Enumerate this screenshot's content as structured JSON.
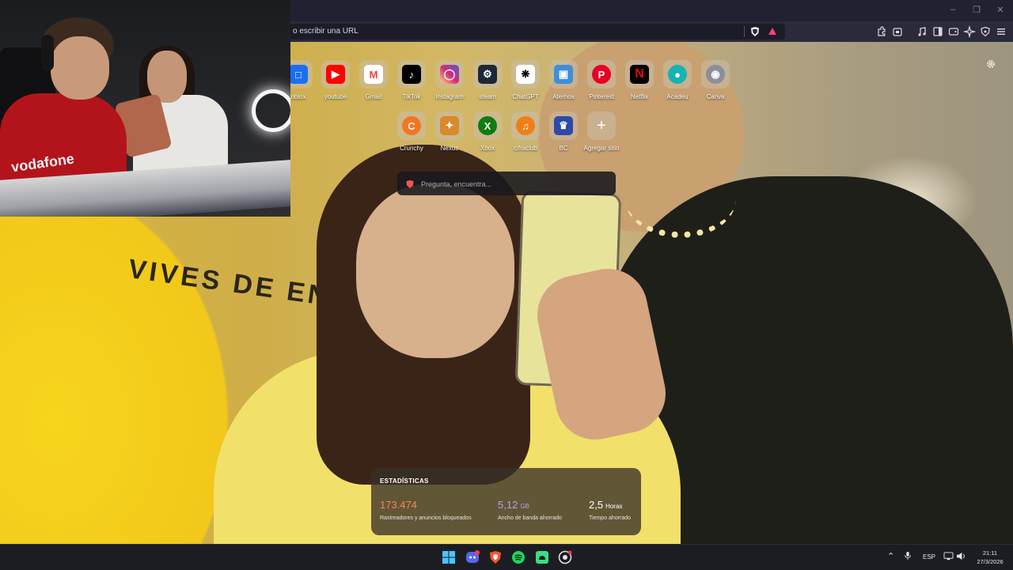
{
  "browser": {
    "url_placeholder": "o escribir una URL"
  },
  "webcam": {
    "shirt_brand": "vodafone"
  },
  "background": {
    "wall_text": "VIVES DE ENSA"
  },
  "speed_dial": {
    "row1": [
      {
        "label": "oblox",
        "icon": "roblox-icon",
        "color": "#1b6ef2"
      },
      {
        "label": "youtube",
        "icon": "youtube-icon",
        "color": "#ff0000"
      },
      {
        "label": "Gmail",
        "icon": "gmail-icon",
        "color": "#ea4335"
      },
      {
        "label": "TikTok",
        "icon": "tiktok-icon",
        "color": "#000000"
      },
      {
        "label": "Instagram",
        "icon": "instagram-icon",
        "color": "#d62976"
      },
      {
        "label": "steam",
        "icon": "steam-icon",
        "color": "#1b2838"
      },
      {
        "label": "ChatGPT",
        "icon": "chatgpt-icon",
        "color": "#ffffff"
      },
      {
        "label": "Aternos",
        "icon": "aternos-icon",
        "color": "#3f8fd8"
      },
      {
        "label": "Pinterest",
        "icon": "pinterest-icon",
        "color": "#e60023"
      },
      {
        "label": "Netflix",
        "icon": "netflix-icon",
        "color": "#000000"
      },
      {
        "label": "Acadeu",
        "icon": "acadeu-icon",
        "color": "#17b3b3"
      },
      {
        "label": "Canva",
        "icon": "canva-icon",
        "color": "#8b8f9a"
      }
    ],
    "row2": [
      {
        "label": "Crunchy",
        "icon": "crunchyroll-icon",
        "color": "#f47521"
      },
      {
        "label": "Nexus",
        "icon": "nexus-icon",
        "color": "#d98a2b"
      },
      {
        "label": "Xbox",
        "icon": "xbox-icon",
        "color": "#107c10"
      },
      {
        "label": "cifraclub",
        "icon": "cifraclub-icon",
        "color": "#f07d19"
      },
      {
        "label": "BC",
        "icon": "bc-icon",
        "color": "#2d4aa8"
      },
      {
        "label": "Agregar sitio",
        "icon": "plus-icon",
        "color": "transparent"
      }
    ]
  },
  "search": {
    "placeholder": "Pregunta, encuentra..."
  },
  "stats": {
    "title": "ESTADÍSTICAS",
    "trackers_value": "173.474",
    "trackers_label": "Rastreadores y anuncios bloqueados",
    "bandwidth_value": "5,12",
    "bandwidth_unit": "GB",
    "bandwidth_label": "Ancho de banda ahorrado",
    "time_value": "2,5",
    "time_unit": "Horas",
    "time_label": "Tiempo ahorrado",
    "colors": {
      "trackers": "#f5865b",
      "bandwidth": "#b99cf5",
      "time": "#ffffff"
    }
  },
  "taskbar": {
    "language": "ESP",
    "time": "21:11",
    "date": "27/3/2026"
  }
}
